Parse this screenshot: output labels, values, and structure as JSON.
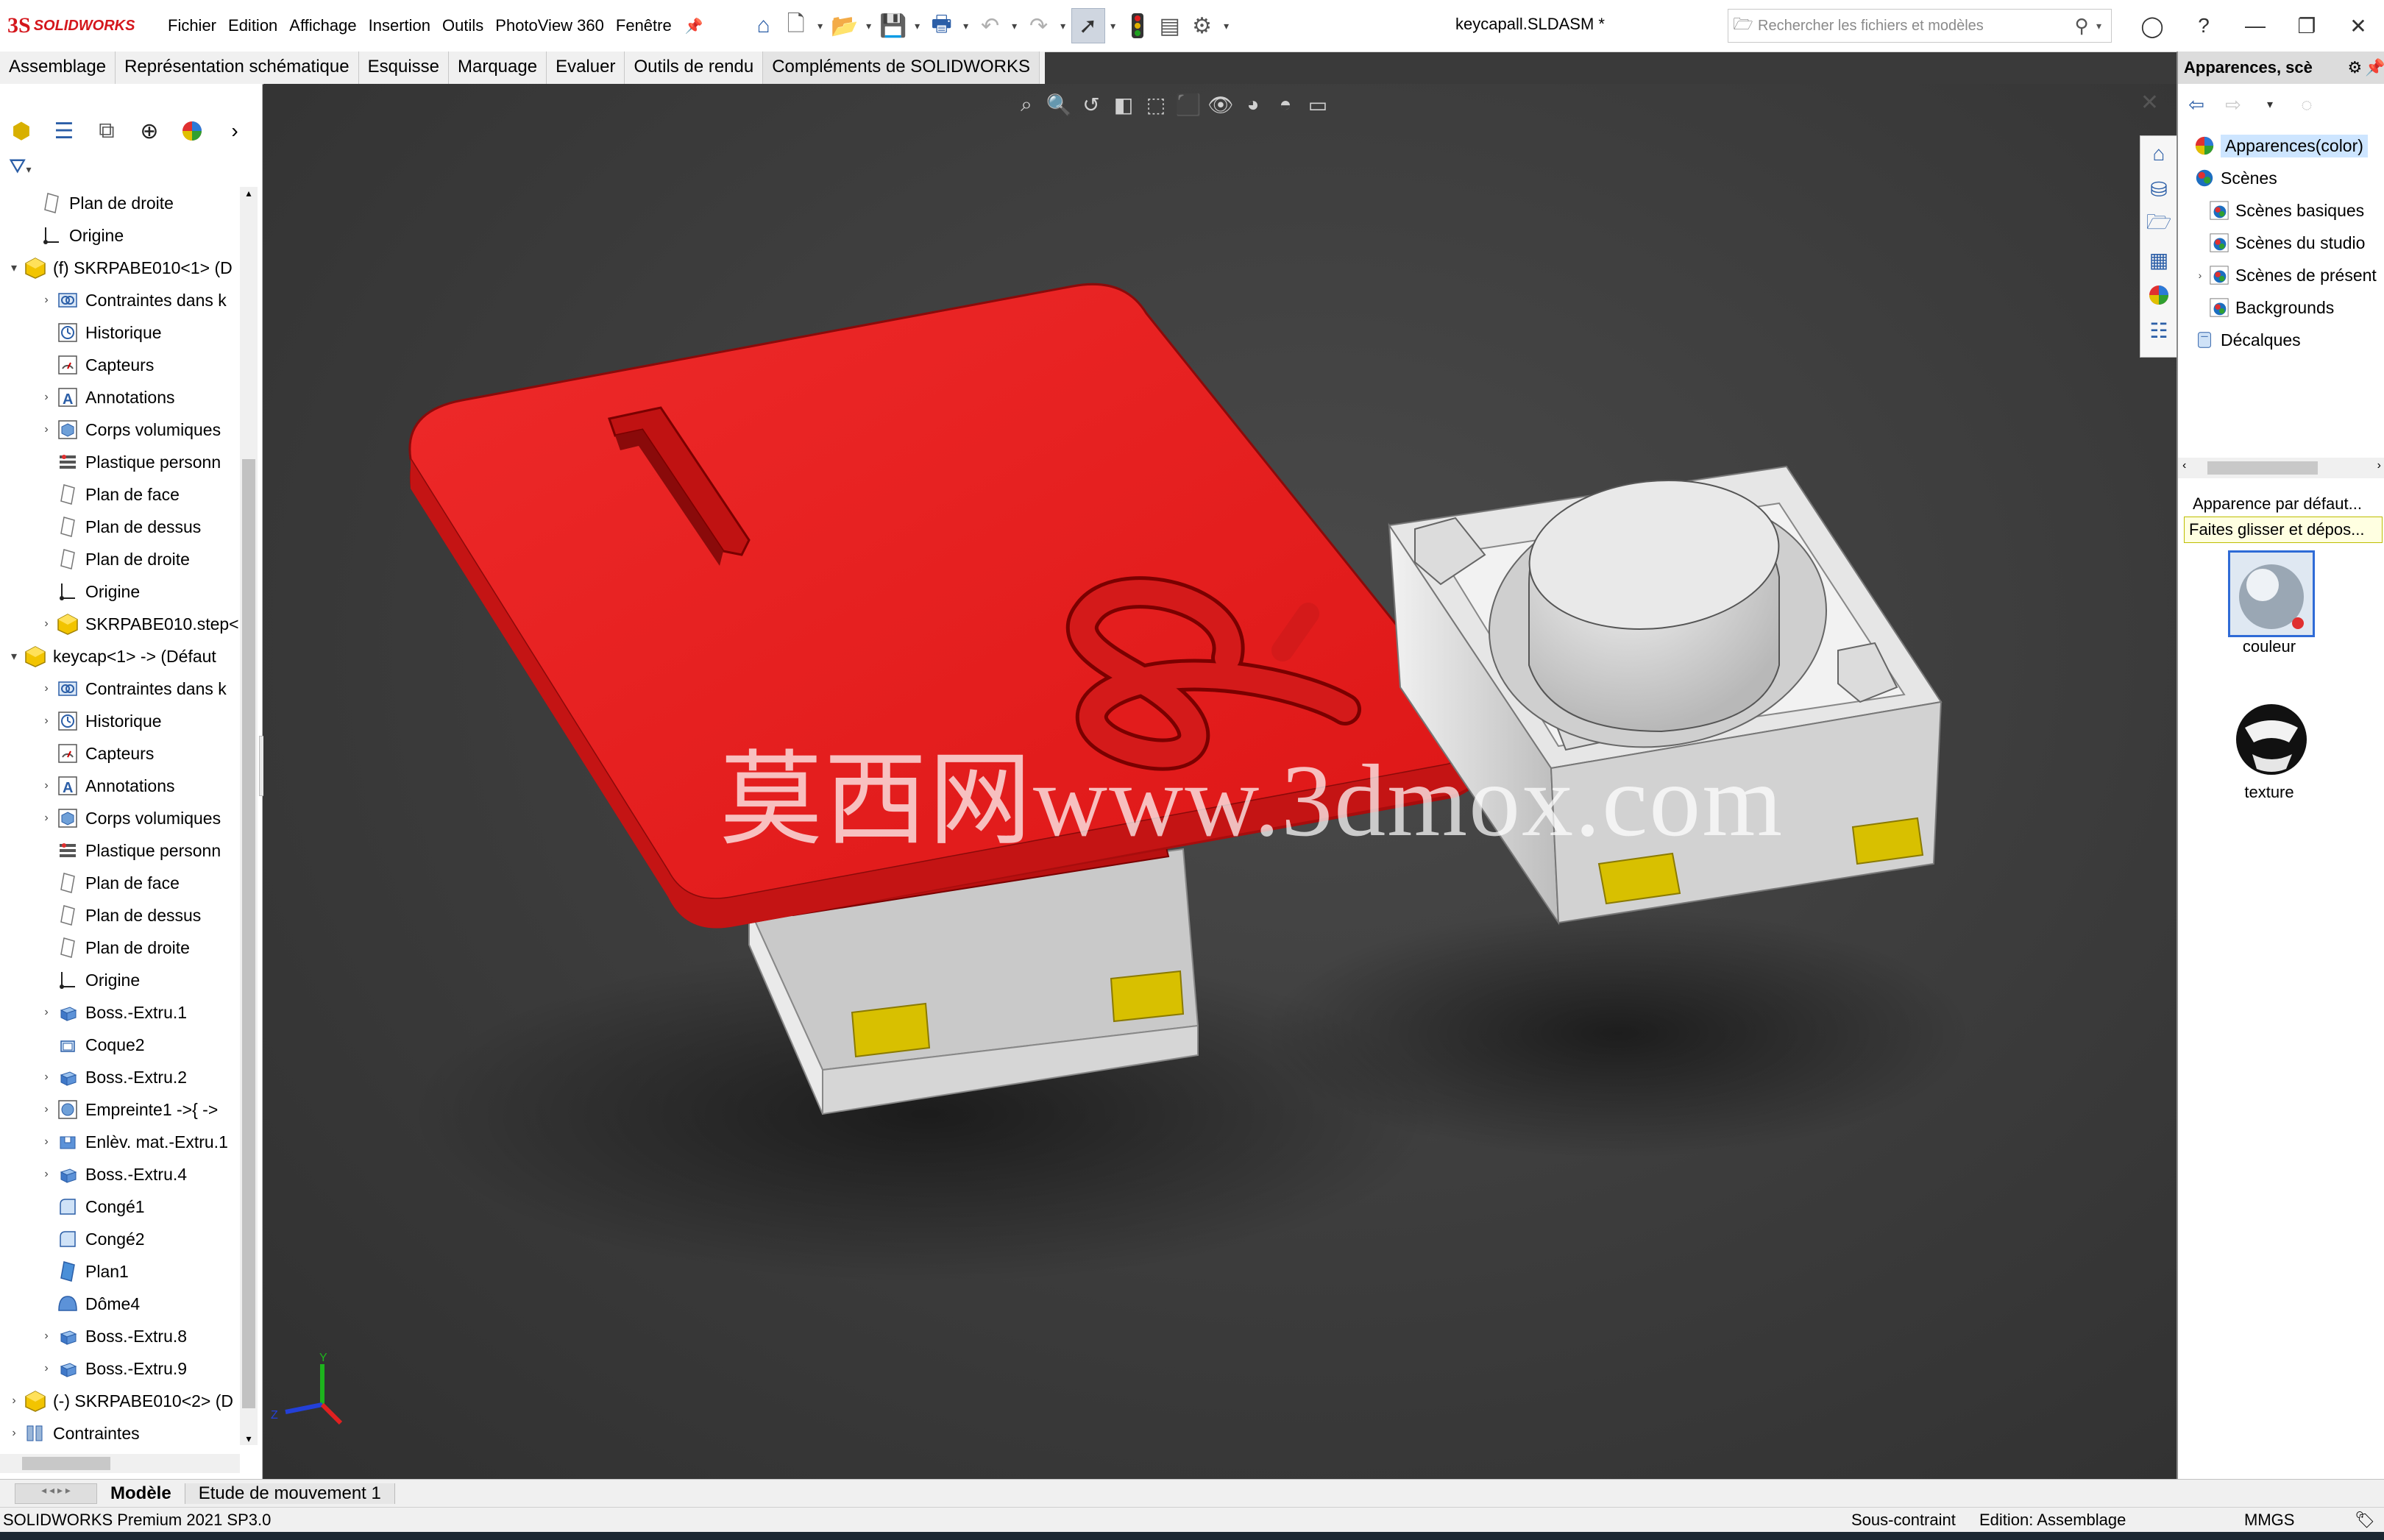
{
  "app": {
    "brand_ds": "3S",
    "brand_name": "SOLIDWORKS",
    "document_title": "keycapall.SLDASM *"
  },
  "menu": [
    "Fichier",
    "Edition",
    "Affichage",
    "Insertion",
    "Outils",
    "PhotoView 360",
    "Fenêtre"
  ],
  "search": {
    "placeholder": "Rechercher les fichiers et modèles"
  },
  "command_tabs": [
    "Assemblage",
    "Représentation schématique",
    "Esquisse",
    "Marquage",
    "Evaluer",
    "Outils de rendu",
    "Compléments de SOLIDWORKS"
  ],
  "tree": [
    {
      "label": "Plan de droite",
      "icon": "plane",
      "level": 1,
      "expand": ""
    },
    {
      "label": "Origine",
      "icon": "origin",
      "level": 1,
      "expand": ""
    },
    {
      "label": "(f) SKRPABE010<1> (D",
      "icon": "part",
      "level": 0,
      "expand": "▾"
    },
    {
      "label": "Contraintes dans k",
      "icon": "mates",
      "level": 2,
      "expand": "›"
    },
    {
      "label": "Historique",
      "icon": "history",
      "level": 2,
      "expand": ""
    },
    {
      "label": "Capteurs",
      "icon": "sensor",
      "level": 2,
      "expand": ""
    },
    {
      "label": "Annotations",
      "icon": "annotation",
      "level": 2,
      "expand": "›"
    },
    {
      "label": "Corps volumiques",
      "icon": "solid",
      "level": 2,
      "expand": "›"
    },
    {
      "label": "Plastique personn",
      "icon": "material",
      "level": 2,
      "expand": ""
    },
    {
      "label": "Plan de face",
      "icon": "plane",
      "level": 2,
      "expand": ""
    },
    {
      "label": "Plan de dessus",
      "icon": "plane",
      "level": 2,
      "expand": ""
    },
    {
      "label": "Plan de droite",
      "icon": "plane",
      "level": 2,
      "expand": ""
    },
    {
      "label": "Origine",
      "icon": "origin",
      "level": 2,
      "expand": ""
    },
    {
      "label": "SKRPABE010.step<",
      "icon": "part",
      "level": 2,
      "expand": "›"
    },
    {
      "label": "keycap<1> -> (Défaut",
      "icon": "part",
      "level": 0,
      "expand": "▾"
    },
    {
      "label": "Contraintes dans k",
      "icon": "mates",
      "level": 2,
      "expand": "›"
    },
    {
      "label": "Historique",
      "icon": "history",
      "level": 2,
      "expand": "›"
    },
    {
      "label": "Capteurs",
      "icon": "sensor",
      "level": 2,
      "expand": ""
    },
    {
      "label": "Annotations",
      "icon": "annotation",
      "level": 2,
      "expand": "›"
    },
    {
      "label": "Corps volumiques",
      "icon": "solid",
      "level": 2,
      "expand": "›"
    },
    {
      "label": "Plastique personn",
      "icon": "material",
      "level": 2,
      "expand": ""
    },
    {
      "label": "Plan de face",
      "icon": "plane",
      "level": 2,
      "expand": ""
    },
    {
      "label": "Plan de dessus",
      "icon": "plane",
      "level": 2,
      "expand": ""
    },
    {
      "label": "Plan de droite",
      "icon": "plane",
      "level": 2,
      "expand": ""
    },
    {
      "label": "Origine",
      "icon": "origin",
      "level": 2,
      "expand": ""
    },
    {
      "label": "Boss.-Extru.1",
      "icon": "extrude",
      "level": 2,
      "expand": "›"
    },
    {
      "label": "Coque2",
      "icon": "shell",
      "level": 2,
      "expand": ""
    },
    {
      "label": "Boss.-Extru.2",
      "icon": "extrude",
      "level": 2,
      "expand": "›"
    },
    {
      "label": "Empreinte1 ->{ ->",
      "icon": "wrap",
      "level": 2,
      "expand": "›"
    },
    {
      "label": "Enlèv. mat.-Extru.1",
      "icon": "cut",
      "level": 2,
      "expand": "›"
    },
    {
      "label": "Boss.-Extru.4",
      "icon": "extrude",
      "level": 2,
      "expand": "›"
    },
    {
      "label": "Congé1",
      "icon": "fillet",
      "level": 2,
      "expand": ""
    },
    {
      "label": "Congé2",
      "icon": "fillet",
      "level": 2,
      "expand": ""
    },
    {
      "label": "Plan1",
      "icon": "plane-solid",
      "level": 2,
      "expand": ""
    },
    {
      "label": "Dôme4",
      "icon": "dome",
      "level": 2,
      "expand": ""
    },
    {
      "label": "Boss.-Extru.8",
      "icon": "extrude",
      "level": 2,
      "expand": "›"
    },
    {
      "label": "Boss.-Extru.9",
      "icon": "extrude",
      "level": 2,
      "expand": "›"
    },
    {
      "label": "(-) SKRPABE010<2> (D",
      "icon": "part",
      "level": 0,
      "expand": "›"
    },
    {
      "label": "Contraintes",
      "icon": "mates-group",
      "level": 0,
      "expand": "›"
    }
  ],
  "viewport": {
    "watermark": "莫西网www.3dmox.com",
    "keycap_legend": "1",
    "keycap_symbol": "&"
  },
  "triad": {
    "y": "Y",
    "z": "Z"
  },
  "task_pane": {
    "title": "Apparences, scè",
    "tree": [
      {
        "label": "Apparences(color)",
        "level": 0,
        "expand": "",
        "selected": true,
        "icon": "appearance"
      },
      {
        "label": "Scènes",
        "level": 0,
        "expand": "",
        "selected": false,
        "icon": "scene"
      },
      {
        "label": "Scènes basiques",
        "level": 1,
        "expand": "",
        "selected": false,
        "icon": "scene-folder"
      },
      {
        "label": "Scènes du studio",
        "level": 1,
        "expand": "",
        "selected": false,
        "icon": "scene-folder"
      },
      {
        "label": "Scènes de présent",
        "level": 1,
        "expand": "›",
        "selected": false,
        "icon": "scene-folder"
      },
      {
        "label": "Backgrounds",
        "level": 1,
        "expand": "",
        "selected": false,
        "icon": "scene-folder"
      },
      {
        "label": "Décalques",
        "level": 0,
        "expand": "",
        "selected": false,
        "icon": "decal"
      }
    ],
    "default_appearance": "Apparence par défaut...",
    "tooltip": "Faites glisser et dépos...",
    "swatches": [
      {
        "label": "couleur"
      },
      {
        "label": "texture"
      }
    ]
  },
  "bottom_tabs": [
    "Modèle",
    "Etude de mouvement 1"
  ],
  "status": {
    "version": "SOLIDWORKS Premium 2021 SP3.0",
    "constraint": "Sous-contraint",
    "edit_mode": "Edition: Assemblage",
    "units": "MMGS"
  },
  "colors": {
    "keycap": "#e31e1e",
    "switch_body": "#d9d9d9",
    "pins": "#d8c000",
    "viewport": "#3d3d3d",
    "brand": "#d4161c"
  }
}
